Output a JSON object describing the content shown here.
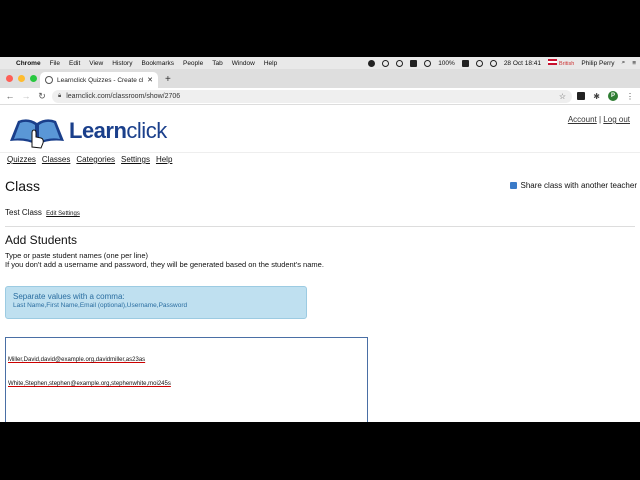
{
  "menubar": {
    "app": "Chrome",
    "items": [
      "File",
      "Edit",
      "View",
      "History",
      "Bookmarks",
      "People",
      "Tab",
      "Window",
      "Help"
    ],
    "battery": "100%",
    "datetime": "28 Oct 18:41",
    "input_source": "British",
    "user": "Philip Perry"
  },
  "browser": {
    "tab_title": "Learnclick Quizzes - Create cl...",
    "url": "learnclick.com/classroom/show/2706",
    "avatar_letter": "P"
  },
  "site": {
    "logo_text_bold": "Learn",
    "logo_text_rest": "click",
    "account_link": "Account",
    "separator": "|",
    "logout_link": "Log out",
    "nav": [
      "Quizzes",
      "Classes",
      "Categories",
      "Settings",
      "Help"
    ]
  },
  "main": {
    "title": "Class",
    "share_label": "Share class with another teacher",
    "class_name": "Test Class",
    "edit_settings": "Edit Settings",
    "add_students_heading": "Add Students",
    "instruction_line1": "Type or paste student names (one per line)",
    "instruction_line2": "If you don't add a username and password, they will be generated based on the student's name.",
    "hint_title": "Separate values with a comma:",
    "hint_format": "Last Name,First Name,Email (optional),Username,Password",
    "students_text": [
      "Miller,David,david@example.org,davidmiller,as23as",
      "White,Stephen,stephen@example.org,stephenwhite,moi245s"
    ]
  },
  "colors": {
    "brand_blue": "#1a3f8b",
    "hint_bg": "#bfe0f0",
    "hint_text": "#2a6da0"
  }
}
